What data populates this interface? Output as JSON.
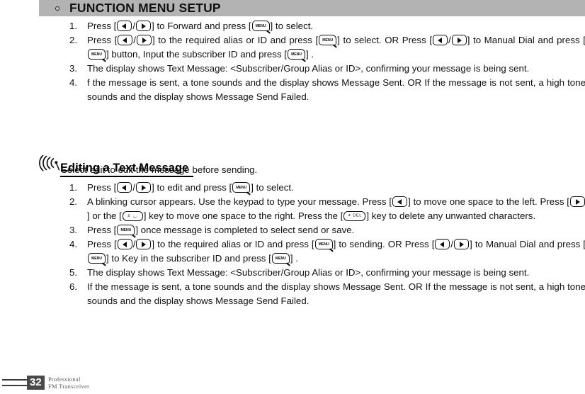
{
  "header": {
    "bullet_icon": "circle-bullet-icon",
    "title": "FUNCTION MENU SETUP"
  },
  "keys": {
    "left_arrow": "left-arrow-key-icon",
    "right_arrow": "right-arrow-key-icon",
    "menu_label": "MENU",
    "hash_label": "#",
    "del_star": "✶",
    "del_label": "DEL"
  },
  "section_one": {
    "steps": [
      {
        "number": "1.",
        "parts": [
          {
            "t": "text",
            "v": "Press ["
          },
          {
            "t": "key",
            "v": "left"
          },
          {
            "t": "text",
            "v": "/"
          },
          {
            "t": "key",
            "v": "right"
          },
          {
            "t": "text",
            "v": "] to Forward and press ["
          },
          {
            "t": "key",
            "v": "menu"
          },
          {
            "t": "text",
            "v": "] to select."
          }
        ]
      },
      {
        "number": "2.",
        "parts": [
          {
            "t": "text",
            "v": "Press ["
          },
          {
            "t": "key",
            "v": "left"
          },
          {
            "t": "text",
            "v": "/"
          },
          {
            "t": "key",
            "v": "right"
          },
          {
            "t": "text",
            "v": "] to the required alias or ID and press ["
          },
          {
            "t": "key",
            "v": "menu"
          },
          {
            "t": "text",
            "v": "] to select. OR Press  ["
          },
          {
            "t": "key",
            "v": "left"
          },
          {
            "t": "text",
            "v": "/"
          },
          {
            "t": "key",
            "v": "right"
          },
          {
            "t": "text",
            "v": "] to Manual Dial and press ["
          },
          {
            "t": "key",
            "v": "menu"
          },
          {
            "t": "text",
            "v": "] button, Input the subscriber ID and press ["
          },
          {
            "t": "key",
            "v": "menu"
          },
          {
            "t": "text",
            "v": "] ."
          }
        ]
      },
      {
        "number": "3.",
        "parts": [
          {
            "t": "text",
            "v": "The display shows Text Message: <Subscriber/Group Alias or ID>, confirming your message is being sent."
          }
        ]
      },
      {
        "number": "4.",
        "parts": [
          {
            "t": "text",
            "v": "f the message is sent, a tone sounds and the display shows Message Sent. OR If the message is not sent, a high tone sounds and the display shows Message Send Failed."
          }
        ]
      }
    ]
  },
  "section_two": {
    "icon": "antenna-signal-icon",
    "heading": "Editing a Text Message",
    "intro": "Select edit to edit the message before sending.",
    "steps": [
      {
        "number": "1.",
        "parts": [
          {
            "t": "text",
            "v": "Press ["
          },
          {
            "t": "key",
            "v": "left"
          },
          {
            "t": "text",
            "v": "/"
          },
          {
            "t": "key",
            "v": "right"
          },
          {
            "t": "text",
            "v": "] to edit and press ["
          },
          {
            "t": "key",
            "v": "menu"
          },
          {
            "t": "text",
            "v": "] to select."
          }
        ]
      },
      {
        "number": "2.",
        "parts": [
          {
            "t": "text",
            "v": "A blinking cursor appears. Use the keypad to type your message. Press ["
          },
          {
            "t": "key",
            "v": "left"
          },
          {
            "t": "text",
            "v": "] to move one space to the left. Press ["
          },
          {
            "t": "key",
            "v": "right"
          },
          {
            "t": "text",
            "v": "]  or the ["
          },
          {
            "t": "key",
            "v": "hash"
          },
          {
            "t": "text",
            "v": "]  key to move one space to the right. Press the ["
          },
          {
            "t": "key",
            "v": "del"
          },
          {
            "t": "text",
            "v": "] key to delete any unwanted characters."
          }
        ]
      },
      {
        "number": "3.",
        "parts": [
          {
            "t": "text",
            "v": "Press ["
          },
          {
            "t": "key",
            "v": "menu"
          },
          {
            "t": "text",
            "v": "] once message is completed to select send or save."
          }
        ]
      },
      {
        "number": "4.",
        "parts": [
          {
            "t": "text",
            "v": "Press ["
          },
          {
            "t": "key",
            "v": "left"
          },
          {
            "t": "text",
            "v": "/"
          },
          {
            "t": "key",
            "v": "right"
          },
          {
            "t": "text",
            "v": "] to the required alias or ID and press ["
          },
          {
            "t": "key",
            "v": "menu"
          },
          {
            "t": "text",
            "v": "] to sending. OR Press ["
          },
          {
            "t": "key",
            "v": "left"
          },
          {
            "t": "text",
            "v": "/"
          },
          {
            "t": "key",
            "v": "right"
          },
          {
            "t": "text",
            "v": "] to Manual Dial and press ["
          },
          {
            "t": "key",
            "v": "menu"
          },
          {
            "t": "text",
            "v": "] to Key in the subscriber ID and press ["
          },
          {
            "t": "key",
            "v": "menu"
          },
          {
            "t": "text",
            "v": "] ."
          }
        ]
      },
      {
        "number": "5.",
        "parts": [
          {
            "t": "text",
            "v": "The display shows Text Message: <Subscriber/Group Alias or ID>, confirming your message is being sent."
          }
        ]
      },
      {
        "number": "6.",
        "parts": [
          {
            "t": "text",
            "v": "If the message is sent, a tone sounds and the display shows Message Sent. OR If the message is not sent, a high tone sounds and the display shows Message Send Failed."
          }
        ]
      }
    ]
  },
  "footer": {
    "page_number": "32",
    "brand_line_1": "Professional",
    "brand_line_2": "FM Transceiver"
  },
  "colors": {
    "header_bar": "#b3b3b3",
    "page_box": "#4a4a4a",
    "text": "#111111",
    "brand_text": "#5a5a5a"
  }
}
